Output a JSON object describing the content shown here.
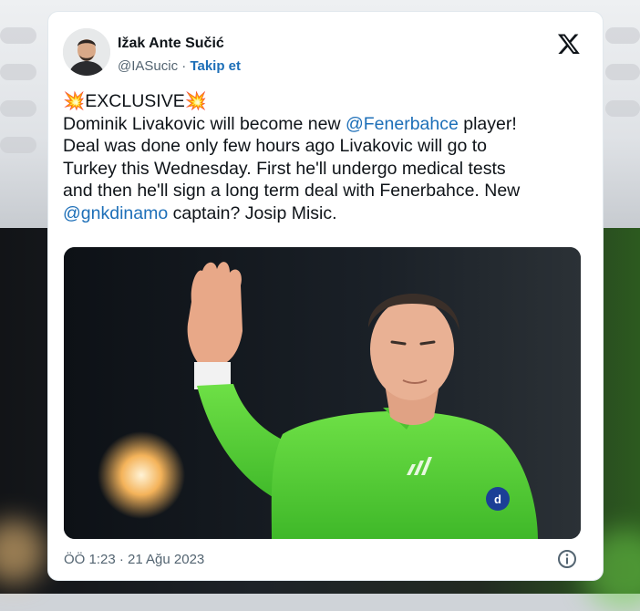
{
  "tweet": {
    "author": {
      "name": "Ižak Ante Sučić",
      "handle": "@IASucic",
      "separator": " · ",
      "follow_label": "Takip et"
    },
    "text": {
      "emoji": "💥",
      "headline": "EXCLUSIVE",
      "line1_a": "Dominik Livakovic will become new ",
      "mention1": "@Fenerbahce",
      "line1_b": " player!",
      "line2": "Deal was done only few hours ago  Livakovic will go to",
      "line3": "Turkey this Wednesday. First he'll undergo medical tests",
      "line4": "and then he'll sign a long term deal with Fenerbahce. New",
      "mention2": "@gnkdinamo",
      "line5_b": " captain? Josip Misic."
    },
    "timestamp": "ÖÖ 1:23 · 21 Ağu 2023",
    "icons": {
      "brand": "x-logo-icon",
      "info": "info-icon"
    },
    "colors": {
      "link": "#1d6fb8",
      "text": "#0f1419",
      "muted": "#536471",
      "jersey": "#5ed43a"
    }
  }
}
